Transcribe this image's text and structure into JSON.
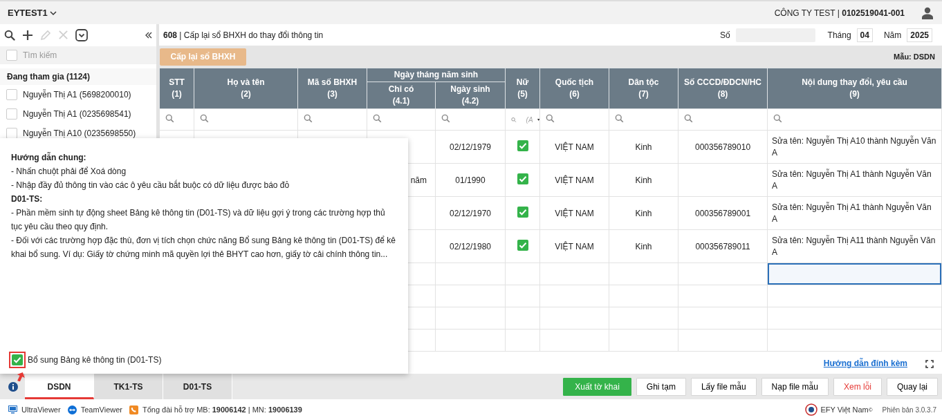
{
  "topbar": {
    "workspace": "EYTEST1",
    "company": "CÔNG TY TEST | **0102519041-001**"
  },
  "sidebar": {
    "toolbar": [
      {
        "kind": "search",
        "disabled": false
      },
      {
        "kind": "add",
        "disabled": false
      },
      {
        "kind": "edit",
        "disabled": true
      },
      {
        "kind": "delete",
        "disabled": true
      },
      {
        "kind": "dropdown",
        "disabled": false
      }
    ],
    "search": {
      "placeholder": "Tìm kiếm",
      "checked": false
    },
    "group": "Đang tham gia (1124)",
    "items": [
      {
        "label": "Nguyễn Thị A1 (5698200010)",
        "checked": false
      },
      {
        "label": "Nguyễn Thị A1 (0235698541)",
        "checked": false
      },
      {
        "label": "Nguyễn Thị A10 (0235698550)",
        "checked": false
      }
    ]
  },
  "sheet": {
    "title": "**608** | Cấp lại sổ BHXH do thay đổi thông tin",
    "number_label": "Số",
    "month_label": "Tháng",
    "month": "04",
    "year_label": "Năm",
    "year": "2025",
    "action_button": "Cấp lại sổ BHXH",
    "template": "Mẫu: DSDN",
    "columns": [
      {
        "label": "STT",
        "number": "(1)"
      },
      {
        "label": "Họ và tên",
        "number": "(2)"
      },
      {
        "label": "Mã số BHXH",
        "number": "(3)"
      },
      {
        "label": "Ngày tháng năm sinh",
        "children": [
          {
            "label": "Chỉ có",
            "number": "(4.1)"
          },
          {
            "label": "Ngày sinh",
            "number": "(4.2)"
          }
        ]
      },
      {
        "label": "Nữ",
        "number": "(5)"
      },
      {
        "label": "Quốc tịch",
        "number": "(6)"
      },
      {
        "label": "Dân tộc",
        "number": "(7)"
      },
      {
        "label": "Số CCCD/ĐDCN/HC",
        "number": "(8)"
      },
      {
        "label": "Nội dung thay đổi, yêu cầu",
        "number": "(9)"
      }
    ],
    "female_filter": "(A",
    "rows": [
      {
        "kind": "data",
        "selected": false,
        "birth_date": "02/12/1979",
        "female": true,
        "nationality": "VIỆT NAM",
        "ethnicity": "Kinh",
        "id_number": "000356789010",
        "change_request": "Sửa tên: Nguyễn Thị A10 thành Nguyễn Văn A"
      },
      {
        "kind": "data",
        "selected": false,
        "date_only": "năm",
        "birth_date": "01/1990",
        "female": true,
        "nationality": "VIỆT NAM",
        "ethnicity": "Kinh",
        "change_request": "Sửa tên: Nguyễn Thị A1 thành Nguyễn Văn A"
      },
      {
        "kind": "data",
        "selected": false,
        "birth_date": "02/12/1970",
        "female": true,
        "nationality": "VIỆT NAM",
        "ethnicity": "Kinh",
        "id_number": "000356789001",
        "change_request": "Sửa tên: Nguyễn Thị A1 thành Nguyễn Văn A"
      },
      {
        "kind": "data",
        "selected": false,
        "birth_date": "02/12/1980",
        "female": true,
        "nationality": "VIỆT NAM",
        "ethnicity": "Kinh",
        "id_number": "000356789011",
        "change_request": "Sửa tên: Nguyễn Thị A11 thành Nguyễn Văn A"
      },
      {
        "kind": "empty",
        "selected": true
      },
      {
        "kind": "empty",
        "selected": false
      },
      {
        "kind": "empty",
        "selected": false
      },
      {
        "kind": "empty",
        "selected": false
      }
    ],
    "guide_link": "Hướng dẫn đính kèm"
  },
  "guide": {
    "lines": [
      {
        "kind": "heading",
        "text": "Hướng dẫn chung:"
      },
      {
        "kind": "item",
        "text": "- Nhấn chuột phải để Xoá dòng"
      },
      {
        "kind": "item",
        "text": "- Nhập đầy đủ thông tin vào các ô yêu cầu bắt buộc có dữ liệu được báo đỏ"
      },
      {
        "kind": "heading",
        "text": "D01-TS:"
      },
      {
        "kind": "item",
        "text": "- Phần mềm sinh tự động sheet Bảng kê thông tin (D01-TS) và dữ liệu gợi ý trong các trường hợp thủ tục yêu cầu theo quy định."
      },
      {
        "kind": "item",
        "text": "- Đối với các trường hợp đặc thù, đơn vị tích chọn chức năng Bổ sung Bảng kê thông tin (D01-TS) để kê khai bổ sung. Ví dụ: Giấy tờ chứng minh mã quyền lợi thẻ BHYT cao hơn, giấy tờ cải chính thông tin..."
      }
    ],
    "option": {
      "label": "Bổ sung Bảng kê thông tin (D01-TS)",
      "checked": true,
      "highlighted": true
    }
  },
  "tabs": [
    {
      "label": "DSDN",
      "selected": true
    },
    {
      "label": "TK1-TS",
      "selected": false
    },
    {
      "label": "D01-TS",
      "selected": false
    }
  ],
  "buttons": [
    {
      "label": "Xuất tờ khai",
      "kind": "primary"
    },
    {
      "label": "Ghi tạm",
      "kind": "default"
    },
    {
      "label": "Lấy file mẫu",
      "kind": "default"
    },
    {
      "label": "Nạp file mẫu",
      "kind": "default"
    },
    {
      "label": "Xem lỗi",
      "kind": "danger"
    },
    {
      "label": "Quay lại",
      "kind": "default"
    }
  ],
  "status_bar": {
    "items": [
      {
        "kind": "ultraviewer",
        "text": "UltraViewer"
      },
      {
        "kind": "teamviewer",
        "text": "TeamViewer"
      },
      {
        "kind": "phone",
        "text": "Tổng đài hỗ trợ MB: **19006142** | MN: **19006139**"
      }
    ],
    "brand": "EFY Việt Nam",
    "brand_mark": "©",
    "version": "Phiên bản 3.0.3.7"
  }
}
